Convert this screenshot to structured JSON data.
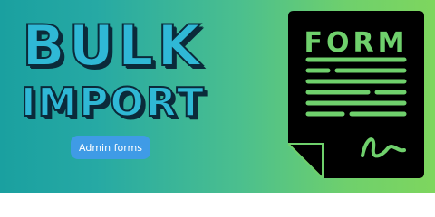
{
  "banner": {
    "title_line1": "BULK",
    "title_line2": "IMPORT",
    "badge_label": "Admin forms",
    "document_label": "FORM"
  },
  "colors": {
    "gradient_start": "#1aa0a0",
    "gradient_end": "#7ed65e",
    "title_fill": "#2fb8d6",
    "title_outline": "#0b2a3a",
    "badge_bg": "#3f9be6",
    "document_bg": "#000000",
    "document_accent": "#6fd06c"
  },
  "icons": [
    "document-icon",
    "signature-icon"
  ]
}
